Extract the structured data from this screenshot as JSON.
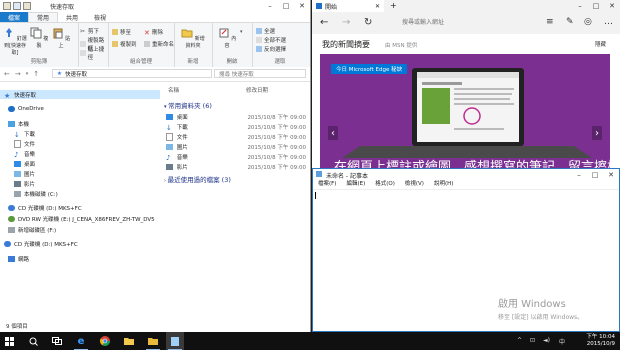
{
  "explorer": {
    "title": "快速存取",
    "tabs": [
      "檔案",
      "常用",
      "共用",
      "檢視"
    ],
    "ribbon": {
      "pin_label": "釘選到[快速存取]",
      "copy_label": "複製",
      "paste_label": "貼上",
      "cut_label": "剪下",
      "copy_path_label": "複製路徑",
      "paste_shortcut_label": "貼上捷徑",
      "move_to_label": "移至",
      "copy_to_label": "複製到",
      "delete_label": "刪除",
      "rename_label": "重新命名",
      "new_folder_label": "新增資料夾",
      "properties_label": "內容",
      "select_all_label": "全選",
      "select_none_label": "全部不選",
      "invert_label": "反向選擇",
      "groups": [
        "剪貼簿",
        "組合管理",
        "新增",
        "開啟",
        "選取"
      ]
    },
    "address": "快速存取",
    "search_placeholder": "搜尋 快速存取",
    "nav": [
      "快速存取",
      "OneDrive",
      "本機",
      "下載",
      "文件",
      "音樂",
      "桌面",
      "圖片",
      "影片",
      "本機磁碟 (C:)",
      "CD 光碟機 (D:) MKS+FC",
      "DVD RW 光碟機 (E:) J_CENA_X86FREV_ZH-TW_DV5",
      "新增磁碟區 (F:)",
      "CD 光碟機 (D:) MKS+FC",
      "網路"
    ],
    "columns": {
      "name": "名稱",
      "modified": "修改日期"
    },
    "frequent_header": "常用資料夾 (6)",
    "frequent": [
      {
        "name": "桌面",
        "date": "2015/10/8 下午 09:00"
      },
      {
        "name": "下載",
        "date": "2015/10/8 下午 09:00"
      },
      {
        "name": "文件",
        "date": "2015/10/8 下午 09:00"
      },
      {
        "name": "圖片",
        "date": "2015/10/8 下午 09:00"
      },
      {
        "name": "音樂",
        "date": "2015/10/8 下午 09:00"
      },
      {
        "name": "影片",
        "date": "2015/10/8 下午 09:00"
      }
    ],
    "recent_header": "最近使用過的檔案 (3)",
    "status": "9 個項目"
  },
  "edge": {
    "tab_title": "開始",
    "url_placeholder": "搜尋或輸入網址",
    "feed_title": "我的新聞摘要",
    "feed_source": "由 MSN 提供",
    "hide_label": "隱藏",
    "hero_badge": "今日 Microsoft Edge 秘訣",
    "hero_caption": "在網頁上標註或繪圖、感想撰寫的筆記，留言擦格標記"
  },
  "notepad": {
    "title": "未命名 - 記事本",
    "menu": [
      "檔案(F)",
      "編輯(E)",
      "格式(O)",
      "檢視(V)",
      "說明(H)"
    ]
  },
  "watermark": {
    "line1": "啟用 Windows",
    "line2": "移至 [設定] 以啟用 Windows。"
  },
  "taskbar": {
    "time": "下午 10:04",
    "date": "2015/10/9"
  }
}
